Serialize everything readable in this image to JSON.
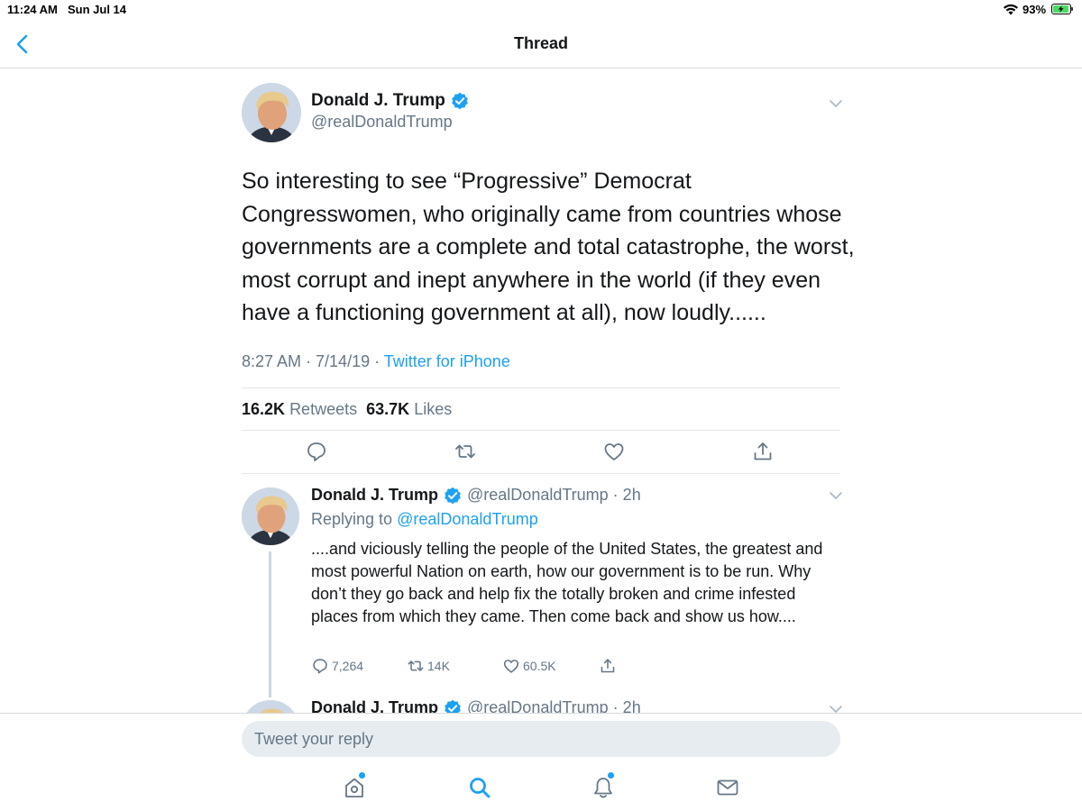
{
  "status_bar": {
    "time": "11:24 AM",
    "date": "Sun Jul 14",
    "battery_percent": "93%",
    "icons": [
      "wifi-icon",
      "battery-charging-icon"
    ]
  },
  "nav": {
    "title": "Thread",
    "back_icon": "chevron-left-icon"
  },
  "main_tweet": {
    "name": "Donald J. Trump",
    "handle": "@realDonaldTrump",
    "verified": true,
    "text": "So interesting to see “Progressive” Democrat Congresswomen, who originally came from countries whose governments are a complete and total catastrophe, the worst, most corrupt and inept anywhere in the world (if they even have a functioning government at all), now loudly......",
    "timestamp": "8:27 AM · 7/14/19 · ",
    "source": "Twitter for iPhone",
    "retweets_count": "16.2K",
    "retweets_label": "Retweets",
    "likes_count": "63.7K",
    "likes_label": "Likes",
    "actions": [
      "reply-icon",
      "retweet-icon",
      "like-icon",
      "share-icon"
    ]
  },
  "reply_tweet": {
    "name": "Donald J. Trump",
    "handle_time": "@realDonaldTrump · 2h",
    "replying_prefix": "Replying to ",
    "replying_to": "@realDonaldTrump",
    "text": "....and viciously telling the people of the United States, the greatest and most powerful Nation on earth, how our government is to be run. Why don’t they go back and help fix the totally broken and crime infested places from which they came. Then come back and show us how....",
    "replies": "7,264",
    "retweets": "14K",
    "likes": "60.5K"
  },
  "next_tweet": {
    "name": "Donald J. Trump",
    "handle_time": "@realDonaldTrump · 2h"
  },
  "reply_bar": {
    "placeholder": "Tweet your reply"
  },
  "tab_bar": {
    "tabs": [
      "home-icon",
      "search-icon",
      "notifications-icon",
      "messages-icon"
    ],
    "accent": "#1da1f2"
  },
  "colors": {
    "accent": "#1da1f2",
    "text": "#14171a",
    "secondary": "#657786"
  }
}
